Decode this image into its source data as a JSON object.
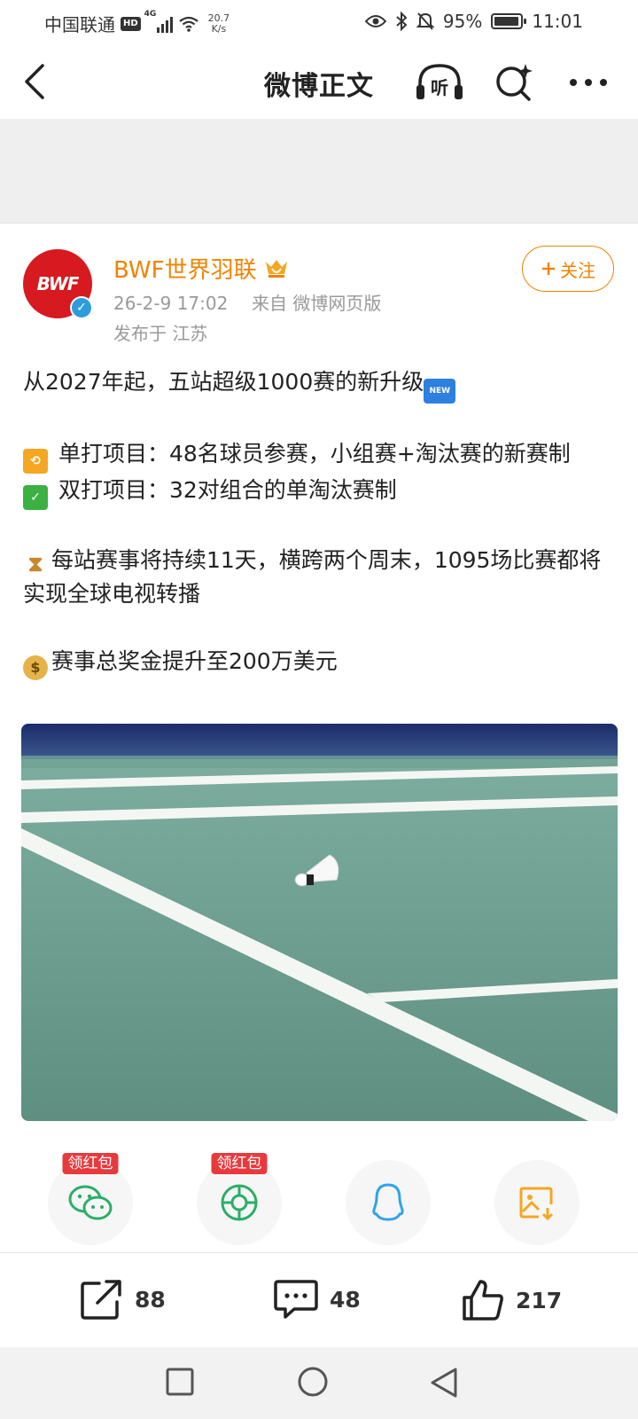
{
  "status_bar": {
    "carrier": "中国联通",
    "hd": "HD",
    "signal": "4G",
    "speed_value": "20.7",
    "speed_unit": "K/s",
    "battery": "95%",
    "time": "11:01"
  },
  "nav": {
    "title": "微博正文",
    "listen_label": "听",
    "icons": [
      "back-arrow-icon",
      "listen-headphone-icon",
      "search-icon",
      "more-icon"
    ]
  },
  "author": {
    "avatar_text": "BWF",
    "name": "BWF世界羽联",
    "timestamp": "26-2-9 17:02",
    "source": "来自 微博网页版",
    "location": "发布于 江苏",
    "follow_label": "关注",
    "accent_color": "#f08300"
  },
  "post": {
    "line1": "从2027年起，五站超级1000赛的新升级",
    "line2": "单打项目：48名球员参赛，小组赛+淘汰赛的新赛制",
    "line3": "双打项目：32对组合的单淘汰赛制",
    "line4": "每站赛事将持续11天，横跨两个周末，1095场比赛都将实现全球电视转播",
    "line5": "赛事总奖金提升至200万美元",
    "new_badge": "NEW"
  },
  "share": {
    "wechat_tag": "领红包",
    "moments_tag": "领红包",
    "icons": [
      "wechat-icon",
      "moments-icon",
      "qq-icon",
      "save-image-icon"
    ]
  },
  "actions": {
    "repost_count": "88",
    "comment_count": "48",
    "like_count": "217"
  }
}
